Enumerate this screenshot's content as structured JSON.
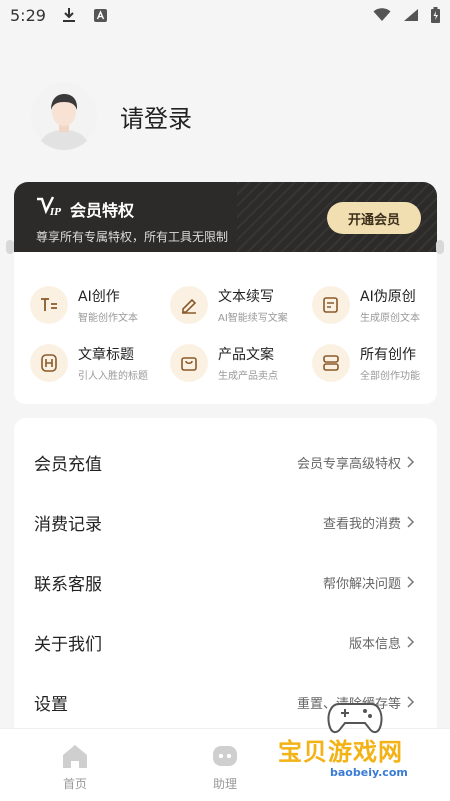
{
  "status_bar": {
    "time": "5:29"
  },
  "profile": {
    "login_prompt": "请登录"
  },
  "vip": {
    "logo": "VIP",
    "title": "会员特权",
    "subtitle": "尊享所有专属特权，所有工具无限制",
    "button": "开通会员"
  },
  "tools": [
    {
      "title": "AI创作",
      "subtitle": "智能创作文本",
      "icon": "text-format-icon"
    },
    {
      "title": "文本续写",
      "subtitle": "AI智能续写文案",
      "icon": "pencil-icon"
    },
    {
      "title": "AI伪原创",
      "subtitle": "生成原创文本",
      "icon": "edit-document-icon"
    },
    {
      "title": "文章标题",
      "subtitle": "引人入胜的标题",
      "icon": "heading-icon"
    },
    {
      "title": "产品文案",
      "subtitle": "生成产品卖点",
      "icon": "shopping-bag-icon"
    },
    {
      "title": "所有创作",
      "subtitle": "全部创作功能",
      "icon": "layers-icon"
    }
  ],
  "menu": [
    {
      "label": "会员充值",
      "hint": "会员专享高级特权"
    },
    {
      "label": "消费记录",
      "hint": "查看我的消费"
    },
    {
      "label": "联系客服",
      "hint": "帮你解决问题"
    },
    {
      "label": "关于我们",
      "hint": "版本信息"
    },
    {
      "label": "设置",
      "hint": "重置、清除缓存等"
    }
  ],
  "bottom_nav": [
    {
      "label": "首页",
      "icon": "home-icon"
    },
    {
      "label": "助理",
      "icon": "chat-bot-icon"
    }
  ],
  "watermark": {
    "text": "宝贝游戏网",
    "url": "baobeiy.com"
  },
  "colors": {
    "vip_bg": "#2c2b29",
    "vip_button": "#f1dfb1",
    "tool_icon_bg": "#fbf1e3",
    "accent": "#c9a66b"
  }
}
